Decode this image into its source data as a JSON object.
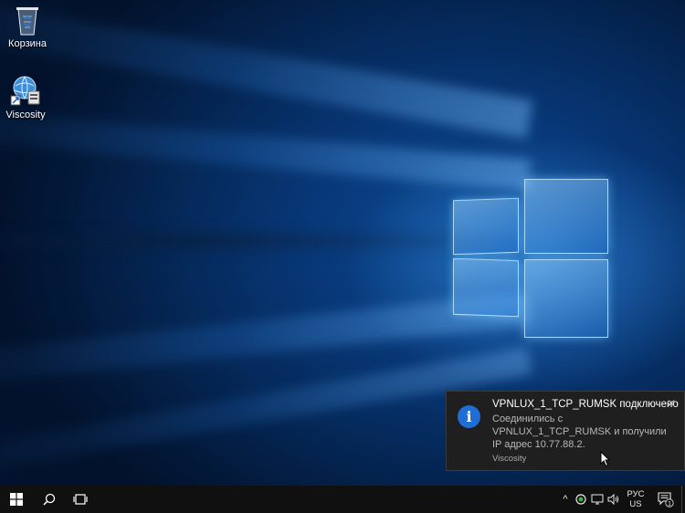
{
  "desktop": {
    "icons": [
      {
        "label": "Корзина",
        "icon": "recycle-bin-icon"
      },
      {
        "label": "Viscosity",
        "icon": "viscosity-icon"
      }
    ]
  },
  "notification": {
    "icon": "info-icon",
    "title": "VPNLUX_1_TCP_RUMSK подключено",
    "body": "Соединились с VPNLUX_1_TCP_RUMSK и получили IP адрес 10.77.88.2.",
    "app": "Viscosity",
    "close": "✕"
  },
  "taskbar": {
    "start_icon": "windows-logo-icon",
    "search_icon": "search-icon",
    "taskview_icon": "task-view-icon",
    "tray": {
      "chevron": "^",
      "language_top": "РУС",
      "language_bottom": "US",
      "notification_count": "1"
    }
  },
  "colors": {
    "toast_background": "#1f1f1f",
    "info_accent": "#1e6ed6",
    "taskbar": "#101010"
  }
}
